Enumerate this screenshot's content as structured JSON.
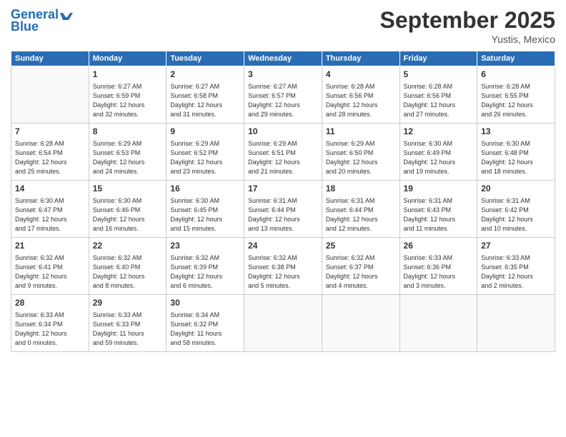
{
  "header": {
    "logo_line1": "General",
    "logo_line2": "Blue",
    "title": "September 2025",
    "subtitle": "Yustis, Mexico"
  },
  "columns": [
    "Sunday",
    "Monday",
    "Tuesday",
    "Wednesday",
    "Thursday",
    "Friday",
    "Saturday"
  ],
  "weeks": [
    [
      {
        "day": "",
        "info": ""
      },
      {
        "day": "1",
        "info": "Sunrise: 6:27 AM\nSunset: 6:59 PM\nDaylight: 12 hours\nand 32 minutes."
      },
      {
        "day": "2",
        "info": "Sunrise: 6:27 AM\nSunset: 6:58 PM\nDaylight: 12 hours\nand 31 minutes."
      },
      {
        "day": "3",
        "info": "Sunrise: 6:27 AM\nSunset: 6:57 PM\nDaylight: 12 hours\nand 29 minutes."
      },
      {
        "day": "4",
        "info": "Sunrise: 6:28 AM\nSunset: 6:56 PM\nDaylight: 12 hours\nand 28 minutes."
      },
      {
        "day": "5",
        "info": "Sunrise: 6:28 AM\nSunset: 6:56 PM\nDaylight: 12 hours\nand 27 minutes."
      },
      {
        "day": "6",
        "info": "Sunrise: 6:28 AM\nSunset: 6:55 PM\nDaylight: 12 hours\nand 26 minutes."
      }
    ],
    [
      {
        "day": "7",
        "info": "Sunrise: 6:28 AM\nSunset: 6:54 PM\nDaylight: 12 hours\nand 25 minutes."
      },
      {
        "day": "8",
        "info": "Sunrise: 6:29 AM\nSunset: 6:53 PM\nDaylight: 12 hours\nand 24 minutes."
      },
      {
        "day": "9",
        "info": "Sunrise: 6:29 AM\nSunset: 6:52 PM\nDaylight: 12 hours\nand 23 minutes."
      },
      {
        "day": "10",
        "info": "Sunrise: 6:29 AM\nSunset: 6:51 PM\nDaylight: 12 hours\nand 21 minutes."
      },
      {
        "day": "11",
        "info": "Sunrise: 6:29 AM\nSunset: 6:50 PM\nDaylight: 12 hours\nand 20 minutes."
      },
      {
        "day": "12",
        "info": "Sunrise: 6:30 AM\nSunset: 6:49 PM\nDaylight: 12 hours\nand 19 minutes."
      },
      {
        "day": "13",
        "info": "Sunrise: 6:30 AM\nSunset: 6:48 PM\nDaylight: 12 hours\nand 18 minutes."
      }
    ],
    [
      {
        "day": "14",
        "info": "Sunrise: 6:30 AM\nSunset: 6:47 PM\nDaylight: 12 hours\nand 17 minutes."
      },
      {
        "day": "15",
        "info": "Sunrise: 6:30 AM\nSunset: 6:46 PM\nDaylight: 12 hours\nand 16 minutes."
      },
      {
        "day": "16",
        "info": "Sunrise: 6:30 AM\nSunset: 6:45 PM\nDaylight: 12 hours\nand 15 minutes."
      },
      {
        "day": "17",
        "info": "Sunrise: 6:31 AM\nSunset: 6:44 PM\nDaylight: 12 hours\nand 13 minutes."
      },
      {
        "day": "18",
        "info": "Sunrise: 6:31 AM\nSunset: 6:44 PM\nDaylight: 12 hours\nand 12 minutes."
      },
      {
        "day": "19",
        "info": "Sunrise: 6:31 AM\nSunset: 6:43 PM\nDaylight: 12 hours\nand 11 minutes."
      },
      {
        "day": "20",
        "info": "Sunrise: 6:31 AM\nSunset: 6:42 PM\nDaylight: 12 hours\nand 10 minutes."
      }
    ],
    [
      {
        "day": "21",
        "info": "Sunrise: 6:32 AM\nSunset: 6:41 PM\nDaylight: 12 hours\nand 9 minutes."
      },
      {
        "day": "22",
        "info": "Sunrise: 6:32 AM\nSunset: 6:40 PM\nDaylight: 12 hours\nand 8 minutes."
      },
      {
        "day": "23",
        "info": "Sunrise: 6:32 AM\nSunset: 6:39 PM\nDaylight: 12 hours\nand 6 minutes."
      },
      {
        "day": "24",
        "info": "Sunrise: 6:32 AM\nSunset: 6:38 PM\nDaylight: 12 hours\nand 5 minutes."
      },
      {
        "day": "25",
        "info": "Sunrise: 6:32 AM\nSunset: 6:37 PM\nDaylight: 12 hours\nand 4 minutes."
      },
      {
        "day": "26",
        "info": "Sunrise: 6:33 AM\nSunset: 6:36 PM\nDaylight: 12 hours\nand 3 minutes."
      },
      {
        "day": "27",
        "info": "Sunrise: 6:33 AM\nSunset: 6:35 PM\nDaylight: 12 hours\nand 2 minutes."
      }
    ],
    [
      {
        "day": "28",
        "info": "Sunrise: 6:33 AM\nSunset: 6:34 PM\nDaylight: 12 hours\nand 0 minutes."
      },
      {
        "day": "29",
        "info": "Sunrise: 6:33 AM\nSunset: 6:33 PM\nDaylight: 11 hours\nand 59 minutes."
      },
      {
        "day": "30",
        "info": "Sunrise: 6:34 AM\nSunset: 6:32 PM\nDaylight: 11 hours\nand 58 minutes."
      },
      {
        "day": "",
        "info": ""
      },
      {
        "day": "",
        "info": ""
      },
      {
        "day": "",
        "info": ""
      },
      {
        "day": "",
        "info": ""
      }
    ]
  ]
}
